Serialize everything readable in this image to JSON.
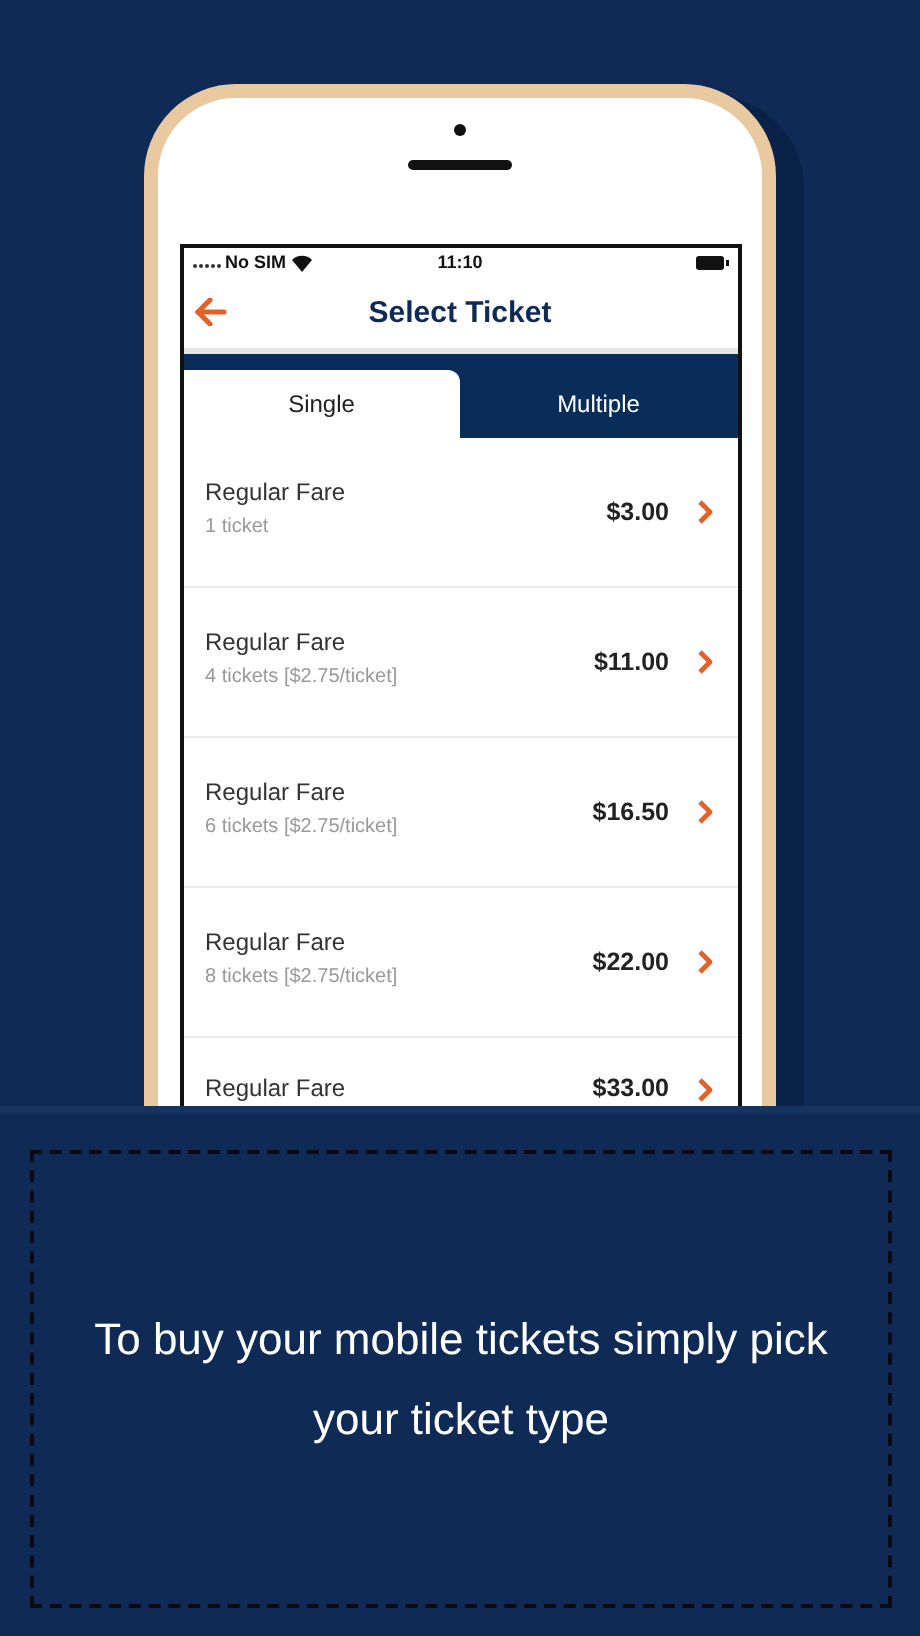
{
  "status_bar": {
    "carrier": "No SIM",
    "time": "11:10"
  },
  "nav": {
    "title": "Select Ticket"
  },
  "tabs": [
    {
      "label": "Single",
      "selected": true
    },
    {
      "label": "Multiple",
      "selected": false
    }
  ],
  "tickets": [
    {
      "title": "Regular Fare",
      "detail": "1 ticket",
      "price": "$3.00"
    },
    {
      "title": "Regular Fare",
      "detail": "4 tickets [$2.75/ticket]",
      "price": "$11.00"
    },
    {
      "title": "Regular Fare",
      "detail": "6 tickets [$2.75/ticket]",
      "price": "$16.50"
    },
    {
      "title": "Regular Fare",
      "detail": "8 tickets [$2.75/ticket]",
      "price": "$22.00"
    },
    {
      "title": "Regular Fare",
      "price": "$33.00"
    }
  ],
  "caption": "To buy your mobile tickets simply pick your ticket type"
}
